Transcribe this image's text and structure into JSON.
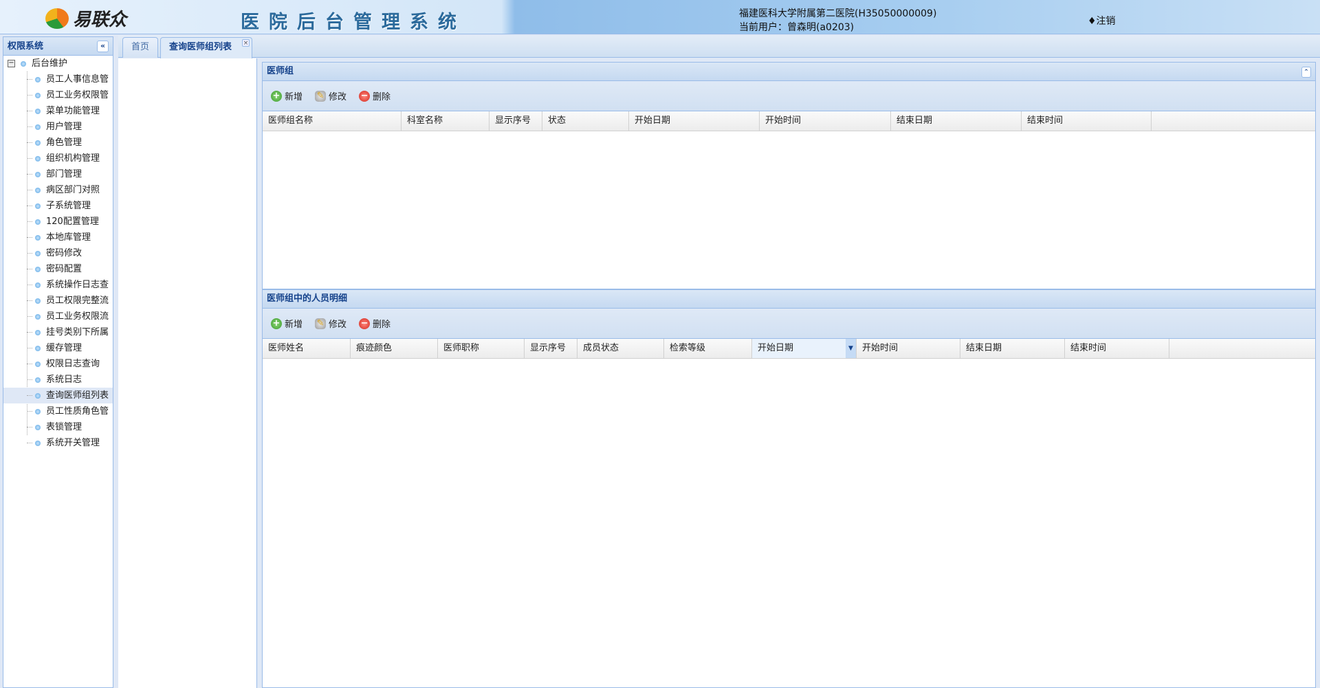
{
  "header": {
    "logo_text": "易联众",
    "system_title": "医院后台管理系统",
    "hospital": "福建医科大学附属第二医院(H35050000009)",
    "current_user": "当前用户：曾森明(a0203)",
    "logout": "♦注销"
  },
  "sidebar": {
    "title": "权限系统",
    "collapse_icon": "«",
    "root": "后台维护",
    "items": [
      "员工人事信息管",
      "员工业务权限管",
      "菜单功能管理",
      "用户管理",
      "角色管理",
      "组织机构管理",
      "部门管理",
      "病区部门对照",
      "子系统管理",
      "120配置管理",
      "本地库管理",
      "密码修改",
      "密码配置",
      "系统操作日志查",
      "员工权限完整流",
      "员工业务权限流",
      "挂号类别下所属",
      "缓存管理",
      "权限日志查询",
      "系统日志",
      "查询医师组列表",
      "员工性质角色管",
      "表锁管理",
      "系统开关管理"
    ],
    "selected_index": 20
  },
  "tabs": [
    {
      "label": "首页"
    },
    {
      "label": "查询医师组列表",
      "close": "×"
    }
  ],
  "panel1": {
    "title": "医师组",
    "toolbar": {
      "add": "新增",
      "edit": "修改",
      "delete": "删除"
    },
    "columns": [
      "医师组名称",
      "科室名称",
      "显示序号",
      "状态",
      "开始日期",
      "开始时间",
      "结束日期",
      "结束时间",
      ""
    ]
  },
  "panel2": {
    "title": "医师组中的人员明细",
    "toolbar": {
      "add": "新增",
      "edit": "修改",
      "delete": "删除"
    },
    "columns": [
      "医师姓名",
      "痕迹颜色",
      "医师职称",
      "显示序号",
      "成员状态",
      "检索等级",
      "开始日期",
      "开始时间",
      "结束日期",
      "结束时间",
      ""
    ]
  }
}
